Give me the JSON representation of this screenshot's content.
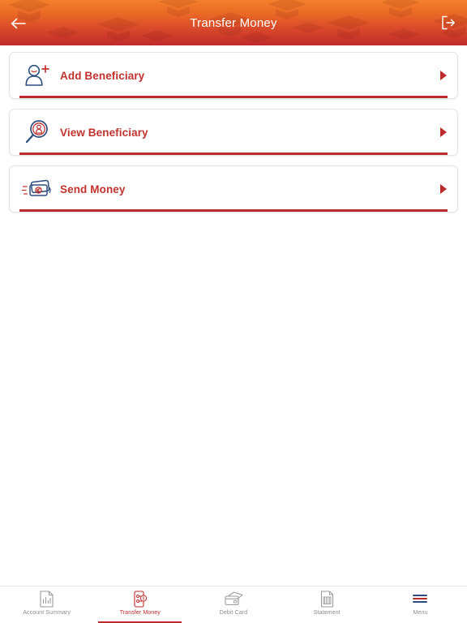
{
  "header": {
    "title": "Transfer Money",
    "back_icon": "arrow-left-icon",
    "logout_icon": "logout-icon",
    "gradient_from": "#f2802a",
    "gradient_to": "#bf2a2b",
    "title_color": "#ffffff"
  },
  "theme": {
    "accent_red": "#bb2b2b",
    "label_red": "#c0332f",
    "icon_blue": "#2c4d7c",
    "page_background": "#ffffff",
    "inactive_gray": "#8d8d8d"
  },
  "cards": [
    {
      "label": "Add Beneficiary",
      "icon": "add-person-icon",
      "chevron": "chevron-right-icon"
    },
    {
      "label": "View Beneficiary",
      "icon": "search-person-icon",
      "chevron": "chevron-right-icon"
    },
    {
      "label": "Send Money",
      "icon": "banknotes-icon",
      "chevron": "chevron-right-icon"
    }
  ],
  "bottom_nav": {
    "items": [
      {
        "label": "Account Summary",
        "icon": "document-chart-icon",
        "active": false
      },
      {
        "label": "Transfer Money",
        "icon": "phone-transfer-icon",
        "active": true
      },
      {
        "label": "Debit Card",
        "icon": "debit-card-icon",
        "active": false
      },
      {
        "label": "Statement",
        "icon": "statement-icon",
        "active": false
      },
      {
        "label": "Menu",
        "icon": "hamburger-menu-icon",
        "active": false
      }
    ]
  }
}
